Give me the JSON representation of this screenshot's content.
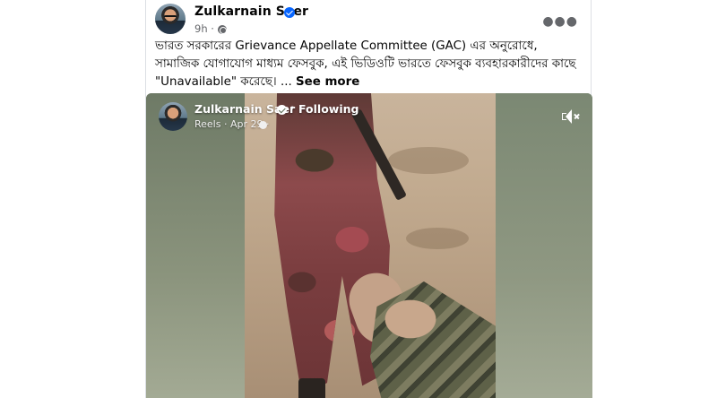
{
  "post": {
    "author": "Zulkarnain Saer",
    "time": "9h ·",
    "text": "ভারত সরকারের Grievance Appellate Committee (GAC) এর অনুরোধে, সামাজিক যোগাযোগ মাধ্যম ফেসবুক, এই ভিডিওটি ভারতে ফেসবুক ব্যবহারকারীদের কাছে \"Unavailable\" করেছে। ...",
    "see_more": "See more",
    "more_icon": "more-horizontal-icon",
    "verified_icon": "verified-badge-icon",
    "audience_icon": "globe-icon"
  },
  "reel": {
    "author": "Zulkarnain Saer",
    "separator": "·",
    "follow_label": "Following",
    "meta": "Reels · Apr 29 ·",
    "mute_icon": "muted-speaker-icon"
  },
  "colors": {
    "accent": "#0866ff",
    "text_primary": "#050505",
    "text_secondary": "#65676b"
  }
}
